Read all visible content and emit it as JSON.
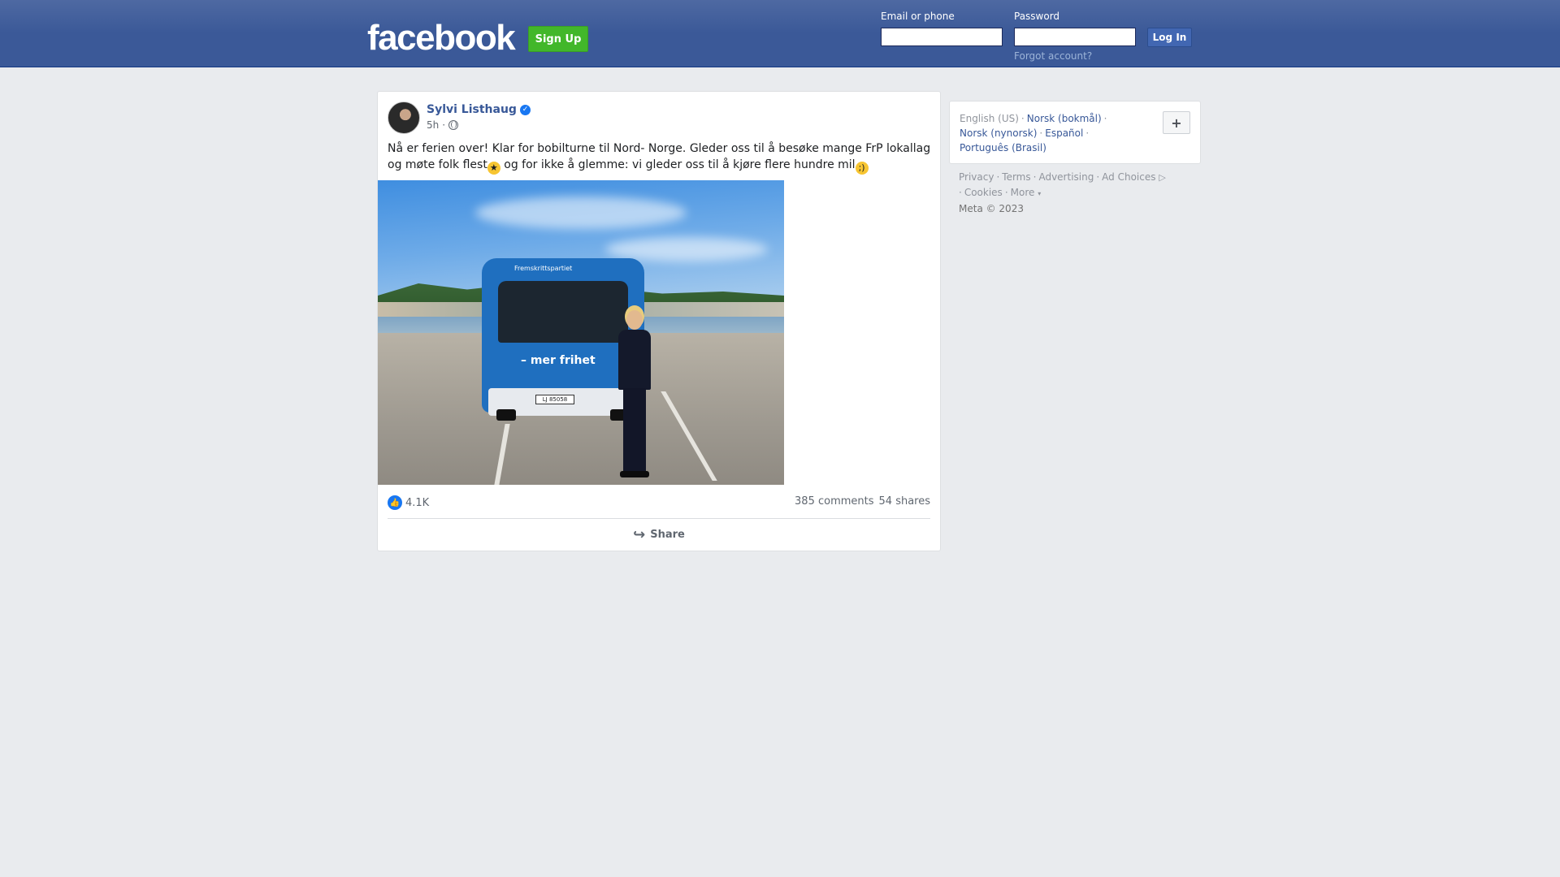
{
  "header": {
    "logo": "facebook",
    "signup_label": "Sign Up",
    "email_label": "Email or phone",
    "password_label": "Password",
    "login_label": "Log In",
    "forgot_label": "Forgot account?"
  },
  "post": {
    "author": "Sylvi Listhaug",
    "time": "5h",
    "text_part1": "Nå er ferien over! Klar for bobilturne til Nord- Norge. Gleder oss til å besøke mange FrP lokallag og møte folk flest",
    "text_part2": " og for ikke å glemme: vi gleder oss til å kjøre flere hundre mil",
    "image_bus_brand": "Fremskrittspartiet",
    "image_slogan": "– mer frihet",
    "image_plate": "LJ 85058",
    "likes": "4.1K",
    "comments": "385 comments",
    "shares": "54 shares",
    "share_label": "Share"
  },
  "languages": {
    "current": "English (US)",
    "items": [
      "Norsk (bokmål)",
      "Norsk (nynorsk)",
      "Español",
      "Português (Brasil)"
    ],
    "add_label": "+"
  },
  "footer": {
    "links": [
      "Privacy",
      "Terms",
      "Advertising",
      "Ad Choices",
      "Cookies",
      "More"
    ],
    "copyright": "Meta © 2023"
  },
  "colors": {
    "header_blue": "#3b5998",
    "signup_green": "#42b72a",
    "link_blue": "#385898",
    "like_blue": "#1877f2"
  }
}
